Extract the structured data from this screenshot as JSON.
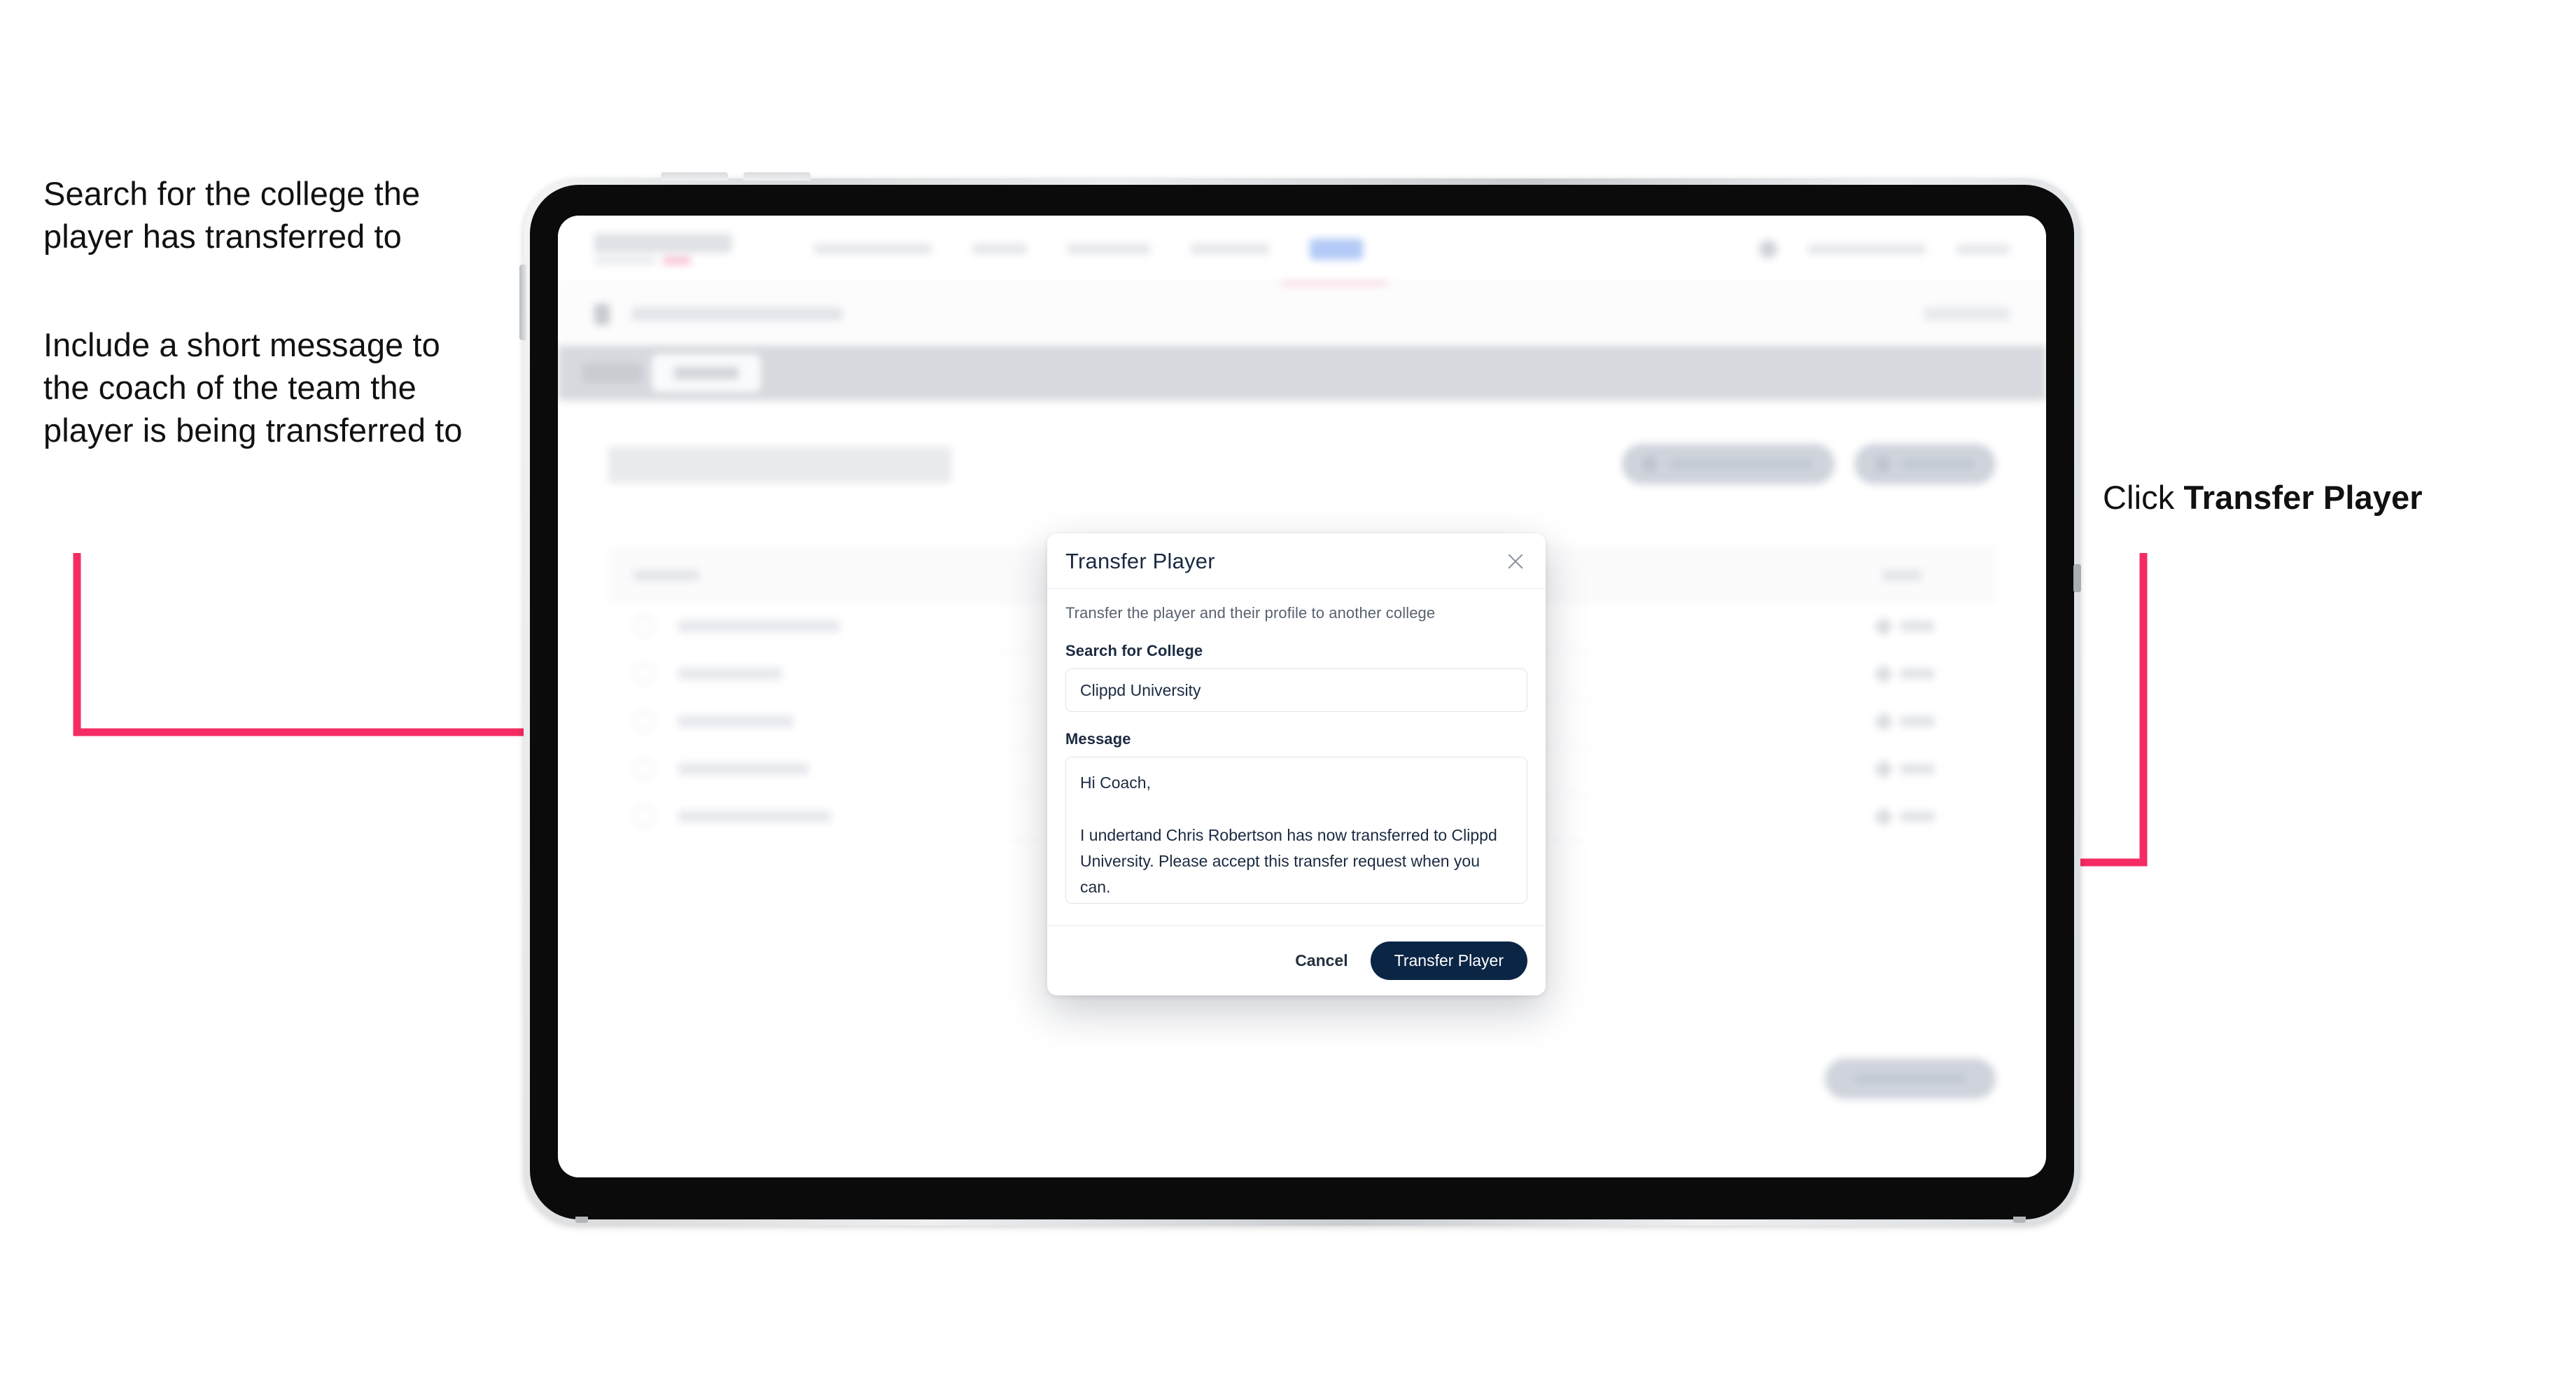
{
  "annotations": {
    "left_1": "Search for the college the player has transferred to",
    "left_2": "Include a short message to the coach of the team the player is being transferred to",
    "right_1_prefix": "Click ",
    "right_1_bold": "Transfer Player"
  },
  "colors": {
    "arrow_pink": "#F42C63",
    "primary_navy": "#0B2545",
    "modal_text": "#1B2A41",
    "muted_text": "#58616F"
  },
  "device": {
    "type": "tablet",
    "hardware": [
      "volume-up-button",
      "volume-down-button",
      "power-button",
      "side-port"
    ]
  },
  "app": {
    "page_title": "Update Roster",
    "nav": {
      "logo": "SCOREBOARD",
      "items": [
        "Tournaments",
        "Teams",
        "Leaderboard",
        "Analytics"
      ],
      "cta": "",
      "user_email": "",
      "sign_out": ""
    },
    "breadcrumb": "Scoreboard",
    "tabs": [
      "Details",
      "Roster"
    ],
    "actions": [
      "Request Player Transfer",
      "Add Player"
    ],
    "table": {
      "headers": [
        "Name",
        "Edit"
      ],
      "rows": [
        "Chris Robertson",
        "Ian Wilson",
        "John Taylor",
        "Lewis Barnes",
        "Nathan Freeman"
      ],
      "row_action": "Edit"
    },
    "footer_button": "Save Roster Changes"
  },
  "modal": {
    "title": "Transfer Player",
    "close_icon": "close-icon",
    "subtitle": "Transfer the player and their profile to another college",
    "fields": {
      "college": {
        "label": "Search for College",
        "value": "Clippd University",
        "placeholder": "Search for College"
      },
      "message": {
        "label": "Message",
        "value": "Hi Coach,\n\nI undertand Chris Robertson has now transferred to Clippd University. Please accept this transfer request when you can.",
        "placeholder": "Message"
      }
    },
    "buttons": {
      "cancel": "Cancel",
      "submit": "Transfer Player"
    }
  }
}
